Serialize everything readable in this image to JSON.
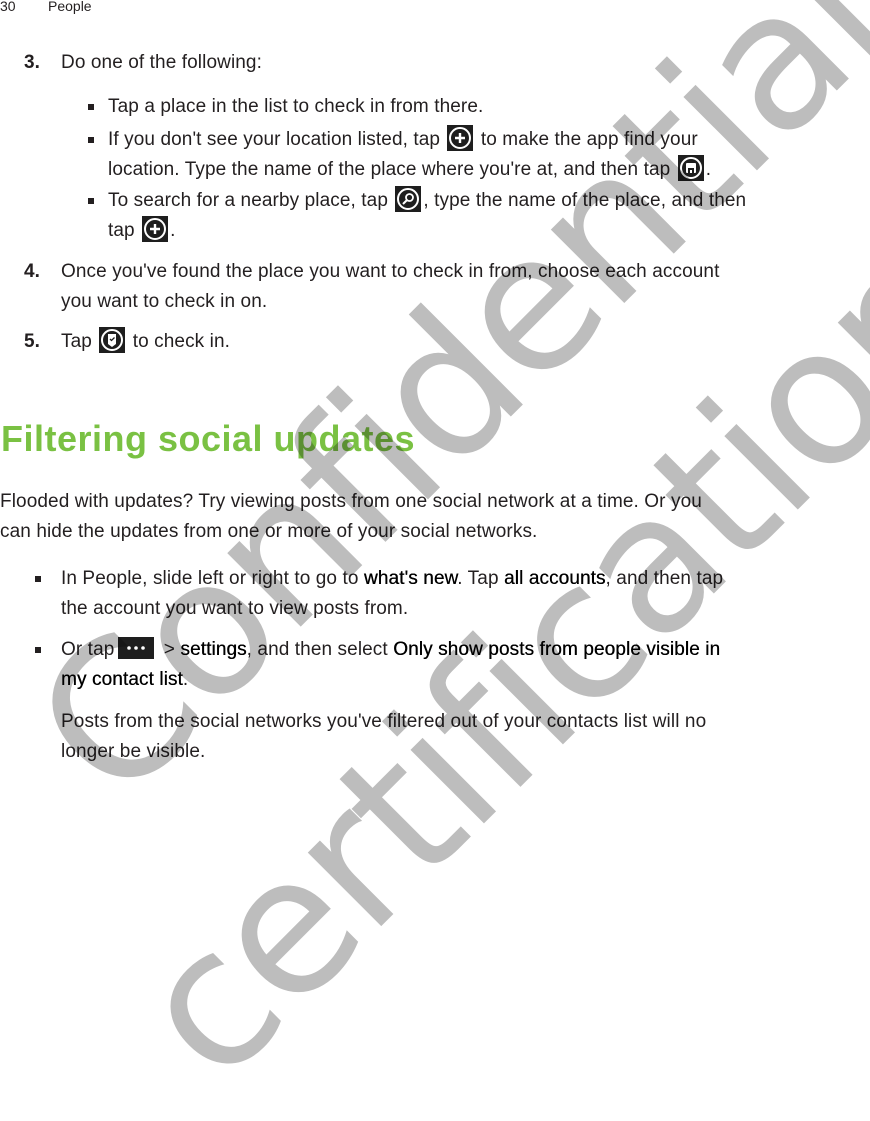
{
  "header": {
    "page_number": "30",
    "section": "People"
  },
  "steps": [
    {
      "number": "3.",
      "text": "Do one of the following:",
      "bullets": [
        {
          "parts": [
            "Tap a place in the list to check in from there."
          ]
        },
        {
          "line1_before": "If you don't see your location listed, tap",
          "line1_after": "to make the app find your",
          "line2_before": "location. Type the name of the place where you're at, and then tap",
          "line2_after": ".",
          "icons": [
            "add-circle-icon",
            "save-icon"
          ]
        },
        {
          "line1_before": "To search for a nearby place, tap",
          "line1_after": ", type the name of the place, and then",
          "line2_before": "tap",
          "line2_after": ".",
          "icons": [
            "search-circle-icon",
            "add-circle-icon"
          ]
        }
      ]
    },
    {
      "number": "4.",
      "line1": "Once you've found the place you want to check in from, choose each account",
      "line2": "you want to check in on."
    },
    {
      "number": "5.",
      "before": "Tap",
      "after": "to check in.",
      "icon": "check-in-icon"
    }
  ],
  "section": {
    "title": "Filtering social updates",
    "title_color": "#7ac143",
    "intro_line1": "Flooded with updates? Try viewing posts from one social network at a time. Or you",
    "intro_line2": "can hide the updates from one or more of your social networks.",
    "bullets": [
      {
        "a": "In People, slide left or right to go to ",
        "b_bold": "what's new",
        "c": ". Tap ",
        "d_bold": "all accounts",
        "e": ", and then tap",
        "line2": "the account you want to view posts from."
      },
      {
        "a": "Or tap",
        "icon": "more-icon",
        "b": " > ",
        "c_bold": "settings",
        "d": ", and then select ",
        "e_bold": "Only show posts from people visible in",
        "line2_bold": "my contact list",
        "line2_end": ".",
        "note_line1": "Posts from the social networks you've filtered out of your contacts list will no",
        "note_line2": "longer be visible."
      }
    ]
  },
  "watermark": {
    "line1": "Confidential",
    "line2": "certification only"
  }
}
